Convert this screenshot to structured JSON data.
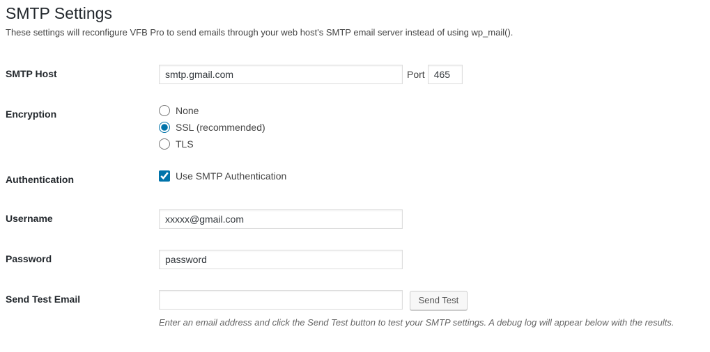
{
  "page": {
    "title": "SMTP Settings",
    "description": "These settings will reconfigure VFB Pro to send emails through your web host's SMTP email server instead of using wp_mail()."
  },
  "labels": {
    "host": "SMTP Host",
    "port": "Port",
    "encryption": "Encryption",
    "auth": "Authentication",
    "username": "Username",
    "password": "Password",
    "sendtest": "Send Test Email"
  },
  "values": {
    "host": "smtp.gmail.com",
    "port": "465",
    "username": "xxxxx@gmail.com",
    "password": "password",
    "test_email": ""
  },
  "encryption": {
    "none": "None",
    "ssl": "SSL (recommended)",
    "tls": "TLS",
    "selected": "ssl"
  },
  "auth": {
    "label": "Use SMTP Authentication",
    "checked": true
  },
  "buttons": {
    "sendtest": "Send Test"
  },
  "help": {
    "sendtest": "Enter an email address and click the Send Test button to test your SMTP settings. A debug log will appear below with the results."
  }
}
